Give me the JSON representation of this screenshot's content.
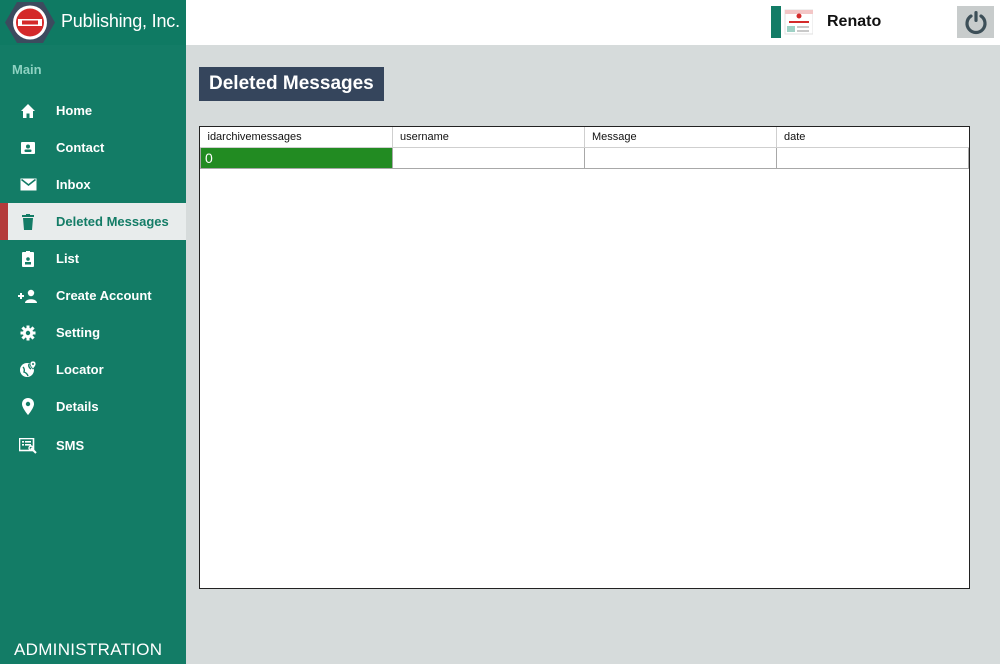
{
  "brand": {
    "name": "Publishing, Inc."
  },
  "sidebar": {
    "section_title": "Main",
    "items": [
      {
        "label": "Home",
        "icon": "home-icon"
      },
      {
        "label": "Contact",
        "icon": "contact-card-icon"
      },
      {
        "label": "Inbox",
        "icon": "mail-icon"
      },
      {
        "label": "Deleted Messages",
        "icon": "trash-icon",
        "active": true
      },
      {
        "label": "List",
        "icon": "badge-icon"
      },
      {
        "label": "Create Account",
        "icon": "add-user-icon"
      },
      {
        "label": "Setting",
        "icon": "gear-icon"
      },
      {
        "label": "Locator",
        "icon": "globe-location-icon"
      },
      {
        "label": "Details",
        "icon": "map-pin-icon"
      },
      {
        "label": "SMS",
        "icon": "sms-icon"
      }
    ],
    "footer": "ADMINISTRATION"
  },
  "header": {
    "username": "Renato",
    "power_icon": "power-icon"
  },
  "main": {
    "title": "Deleted Messages",
    "table": {
      "columns": [
        "idarchivemessages",
        "username",
        "Message",
        "date"
      ],
      "rows": [
        [
          "0",
          "",
          "",
          ""
        ]
      ]
    }
  },
  "colors": {
    "sidebar": "#137c66",
    "active_marker": "#b43b3b",
    "title_bg": "#35455c",
    "selected_cell": "#228b22",
    "page_bg": "#d6dbdb"
  }
}
